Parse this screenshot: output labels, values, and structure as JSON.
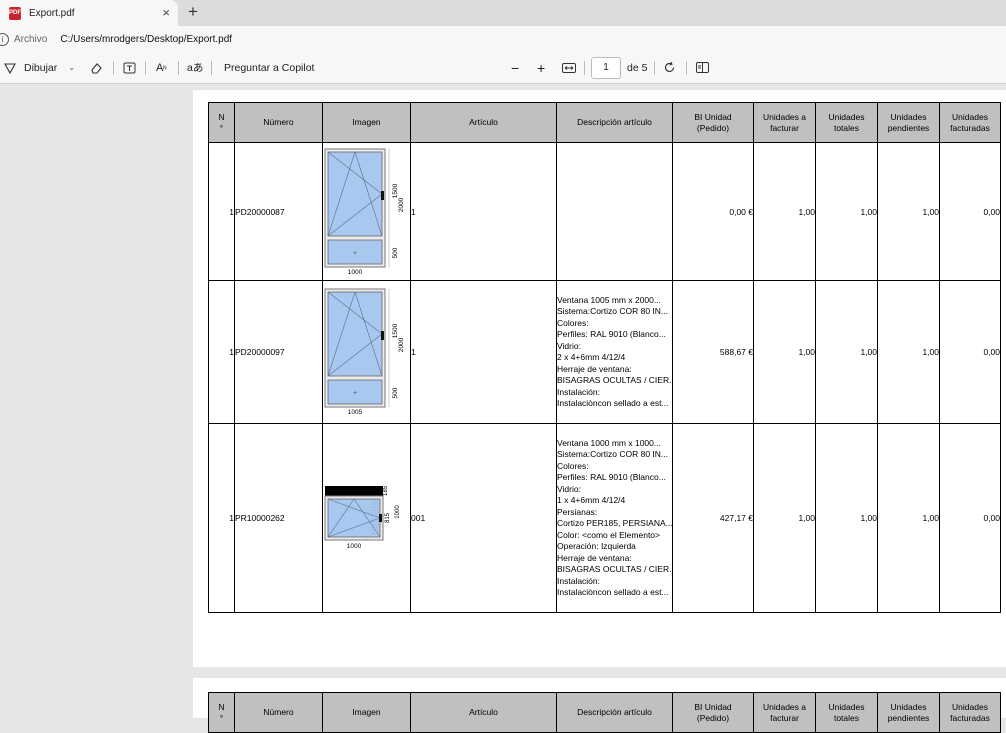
{
  "tab": {
    "title": "Export.pdf",
    "close_icon": "×",
    "new_tab_icon": "+"
  },
  "address": {
    "label": "Archivo",
    "path": "C:/Users/mrodgers/Desktop/Export.pdf"
  },
  "toolbar": {
    "draw_label": "Dibujar",
    "copilot_label": "Preguntar a Copilot",
    "page_current": "1",
    "page_total": "de 5"
  },
  "table": {
    "headers": [
      "N\n°",
      "Número",
      "Imagen",
      "Artículo",
      "Descripción artículo",
      "BI Unidad\n(Pedido)",
      "Unidades a\nfacturar",
      "Unidades\ntotales",
      "Unidades\npendientes",
      "Unidades\nfacturadas"
    ],
    "rows": [
      {
        "n": "1",
        "numero": "PD20000087",
        "articulo": "1",
        "descripcion": [],
        "bi": "0,00 €",
        "a_facturar": "1,00",
        "totales": "1,00",
        "pendientes": "1,00",
        "facturadas": "0,00",
        "img": {
          "width": "1000",
          "upper": "1500",
          "lower": "500",
          "total": "2000"
        }
      },
      {
        "n": "1",
        "numero": "PD20000097",
        "articulo": "1",
        "descripcion": [
          "Ventana 1005 mm x 2000...",
          "Sistema:Cortizo COR 80 IN...",
          "Colores:",
          "Perfiles: RAL 9010 (Blanco...",
          "Vidrio:",
          "2 x 4+6mm 4/12/4",
          "Herraje de ventana:",
          "BISAGRAS OCULTAS / CIER...",
          "Instalación:",
          "Instalaciòncon sellado a est..."
        ],
        "bi": "588,67 €",
        "a_facturar": "1,00",
        "totales": "1,00",
        "pendientes": "1,00",
        "facturadas": "0,00",
        "img": {
          "width": "1005",
          "upper": "1500",
          "lower": "500",
          "total": "2000"
        }
      },
      {
        "n": "1",
        "numero": "PR10000262",
        "articulo": "001",
        "descripcion": [
          "Ventana 1000 mm x 1000...",
          "Sistema:Cortizo COR 80 IN...",
          "Colores:",
          "Perfiles: RAL 9010 (Blanco...",
          "Vidrio:",
          "1 x 4+6mm 4/12/4",
          "Persianas:",
          "Cortizo PER185, PERSIANA...",
          "Color: <como el Elemento>",
          "Operación: Izquierda",
          "Herraje de ventana:",
          "BISAGRAS OCULTAS / CIER...",
          "Instalación:",
          "Instalaciòncon sellado a est..."
        ],
        "bi": "427,17 €",
        "a_facturar": "1,00",
        "totales": "1,00",
        "pendientes": "1,00",
        "facturadas": "0,00",
        "img": {
          "width": "1000",
          "box": "185",
          "glass": "815",
          "total": "1000"
        }
      }
    ]
  },
  "colors": {
    "header_bg": "#c0c0c0",
    "glass": "#a9c8f0",
    "pdf_icon": "#c4262e"
  }
}
